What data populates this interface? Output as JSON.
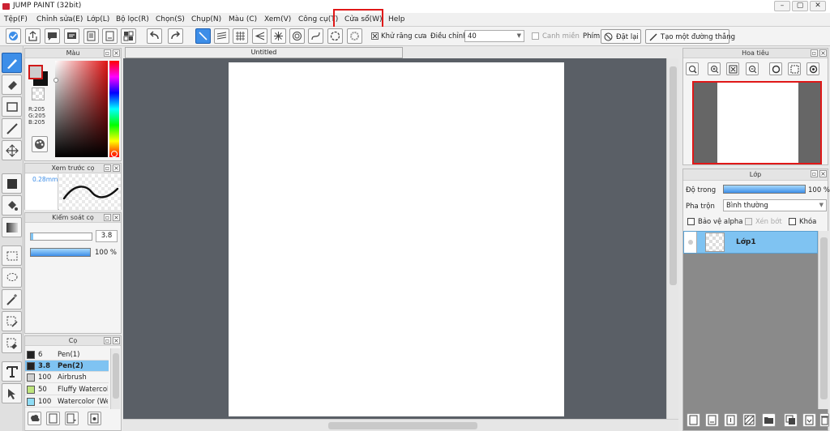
{
  "window": {
    "title": "JUMP PAINT (32bit)",
    "min": "–",
    "max": "▢",
    "close": "✕"
  },
  "menu": [
    "Tệp(F)",
    "Chỉnh sửa(E)",
    "Lớp(L)",
    "Bộ lọc(R)",
    "Chọn(S)",
    "Chụp(N)",
    "Màu (C)",
    "Xem(V)",
    "Công cụ(T)",
    "Cửa sổ(W)",
    "Help"
  ],
  "toolbar": {
    "antialias_label": "Khử răng cưa",
    "adjust_label": "Điều chỉnh",
    "adjust_value": "40",
    "margin_label": "Canh miền",
    "key_label": "Phím",
    "reset_label": "Đặt lại",
    "straight_line_label": "Tạo một đường thẳng"
  },
  "color_panel": {
    "title": "Màu",
    "r": "R:205",
    "g": "G:205",
    "b": "B:205",
    "fg_color": "#cdcdcd",
    "bg_color": "#111111",
    "accent": "#d01818"
  },
  "brush_preview": {
    "title": "Xem trước cọ",
    "size": "0.28mm"
  },
  "brush_control": {
    "title": "Kiểm soát cọ",
    "size_value": "3.8",
    "opacity_value": "100 %"
  },
  "brush_panel": {
    "title": "Cọ",
    "items": [
      {
        "size": "6",
        "name": "Pen(1)",
        "color": "#222222"
      },
      {
        "size": "3.8",
        "name": "Pen(2)",
        "color": "#222222"
      },
      {
        "size": "100",
        "name": "Airbrush",
        "color": "#cfcfcf"
      },
      {
        "size": "50",
        "name": "Fluffy Watercolor",
        "color": "#bfe57e"
      },
      {
        "size": "100",
        "name": "Watercolor (Wet)",
        "color": "#8edcf5"
      }
    ]
  },
  "document": {
    "tab": "Untitled"
  },
  "navigator": {
    "title": "Hoa tiêu"
  },
  "layers": {
    "title": "Lớp",
    "opacity_label": "Độ trong",
    "opacity_value": "100 %",
    "blend_label": "Pha trộn",
    "blend_value": "Bình thường",
    "alpha_label": "Bảo vệ alpha",
    "clip_label": "Xén bớt",
    "lock_label": "Khóa",
    "layer_name": "Lớp1"
  }
}
